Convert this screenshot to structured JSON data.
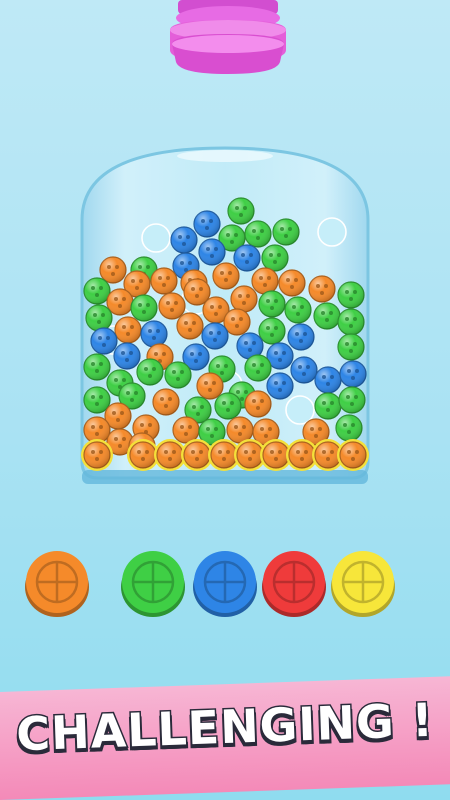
{
  "caption": {
    "text": "CHALLENGING !"
  },
  "colors": {
    "orange": "#f58a2a",
    "green": "#3fcf45",
    "blue": "#2e85e6",
    "red": "#ef3b3b",
    "yellow": "#f7e63a",
    "funnel": "#e45fd9",
    "highlight": "#f4e03a"
  },
  "targets": [
    {
      "color": "orange",
      "icon": "crosshair-icon"
    },
    {
      "color": "green",
      "icon": "crosshair-icon"
    },
    {
      "color": "blue",
      "icon": "crosshair-icon"
    },
    {
      "color": "red",
      "icon": "crosshair-icon"
    },
    {
      "color": "yellow",
      "icon": "crosshair-icon"
    }
  ]
}
